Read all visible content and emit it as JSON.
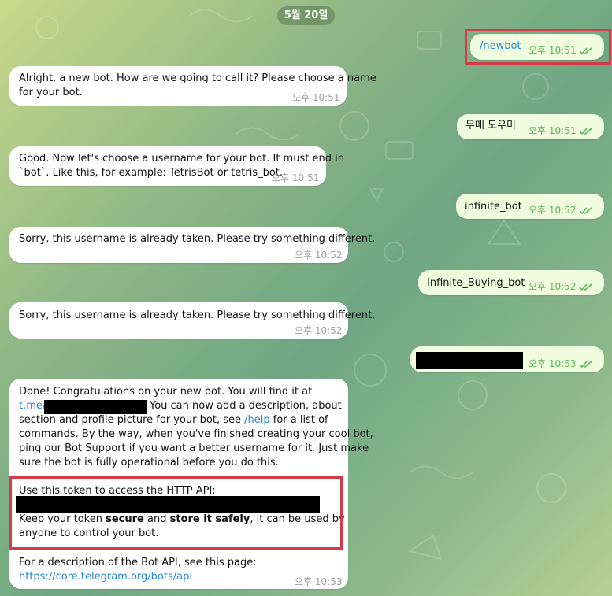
{
  "date_label": "5월 20일",
  "messages": {
    "m1": {
      "text": "/newbot",
      "time": "오후 10:51"
    },
    "m2": {
      "line1": "Alright, a new bot. How are we going to call it? Please choose a name",
      "line2": "for your bot.",
      "time": "오후 10:51"
    },
    "m3": {
      "text": "무매 도우미",
      "time": "오후 10:51"
    },
    "m4": {
      "line1": "Good. Now let's choose a username for your bot. It must end in",
      "line2": "`bot`. Like this, for example: TetrisBot or tetris_bot.",
      "time": "오후 10:51"
    },
    "m5": {
      "text": "infinite_bot",
      "time": "오후 10:52"
    },
    "m6": {
      "text": "Sorry, this username is already taken. Please try something different.",
      "time": "오후 10:52"
    },
    "m7": {
      "text": "Infinite_Buying_bot",
      "time": "오후 10:52"
    },
    "m8": {
      "text": "Sorry, this username is already taken. Please try something different.",
      "time": "오후 10:52"
    },
    "m9": {
      "time": "오후 10:53"
    },
    "m10": {
      "line1": "Done! Congratulations on your new bot. You will find it at",
      "link_tme": "t.me/",
      "line2_rest": "You can now add a description, about",
      "line3a": "section and profile picture for your bot, see ",
      "help_link": "/help",
      "line3b": " for a list of",
      "line4": "commands. By the way, when you've finished creating your cool bot,",
      "line5": "ping our Bot Support if you want a better username for it. Just make",
      "line6": "sure the bot is fully operational before you do this.",
      "token_line": "Use this token to access the HTTP API:",
      "keep_a": "Keep your token ",
      "keep_secure": "secure",
      "keep_and": " and ",
      "keep_store": "store it safely",
      "keep_b": ", it can be used by",
      "keep_line2": "anyone to control your bot.",
      "api_line": "For a description of the Bot API, see this page:",
      "api_link": "https://core.telegram.org/bots/api",
      "time": "오후 10:53"
    }
  },
  "colors": {
    "incoming": "#ffffff",
    "outgoing": "#effdde",
    "link": "#2a86d6",
    "highlight": "#d23b47",
    "check": "#5eb45b"
  }
}
